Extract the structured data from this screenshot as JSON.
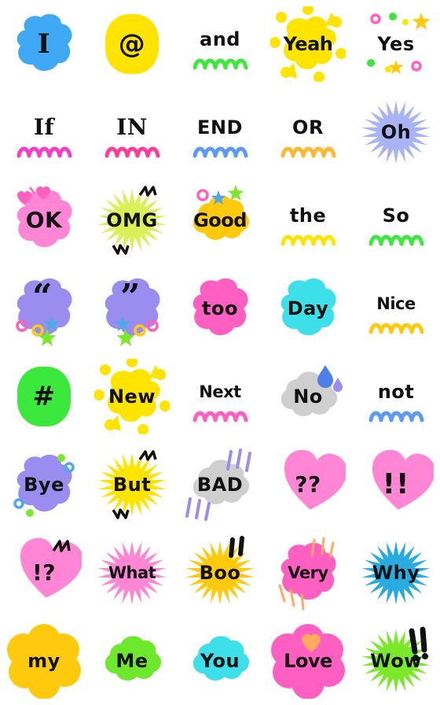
{
  "page": {
    "title": "Emoji sticker sheet",
    "background_color": "#ffffff",
    "grid": {
      "columns": 5,
      "rows": 8,
      "cell_size_px": 112
    },
    "text_color": "#111111"
  },
  "palette": {
    "blue": "#3FA9F5",
    "yellow": "#FFE400",
    "gold": "#FFC90E",
    "green": "#3DE83D",
    "lime": "#7BE82C",
    "yellow_green": "#D9F05A",
    "pink": "#FF85D5",
    "hot_pink": "#FF5FC0",
    "magenta": "#F53DC8",
    "purple": "#9B8CF0",
    "periwinkle": "#A8B4F5",
    "cyan": "#3DE0E8",
    "sky": "#29ABE2",
    "gray": "#CFCFCF",
    "orange": "#FFAA5C"
  },
  "stickers": [
    {
      "id": "i",
      "label": "I",
      "bg": "blob",
      "bg_color": "#3FA9F5",
      "deco": "none",
      "size": "s-xl",
      "font": "serif"
    },
    {
      "id": "at",
      "label": "@",
      "bg": "round",
      "bg_color": "#FFE400",
      "deco": "none",
      "size": "s-xl",
      "font": ""
    },
    {
      "id": "and",
      "label": "and",
      "bg": "none",
      "bg_color": "",
      "deco": "squiggle",
      "deco_color": "#3DE83D",
      "size": "s-md",
      "font": ""
    },
    {
      "id": "yeah",
      "label": "Yeah",
      "bg": "splat",
      "bg_color": "#FFE400",
      "deco": "none",
      "size": "s-md",
      "font": ""
    },
    {
      "id": "yes",
      "label": "Yes",
      "bg": "none",
      "bg_color": "",
      "deco": "confetti",
      "size": "s-md",
      "font": ""
    },
    {
      "id": "if",
      "label": "If",
      "bg": "none",
      "bg_color": "",
      "deco": "squiggle",
      "deco_color": "#F53DC8",
      "size": "s-lg",
      "font": "serif"
    },
    {
      "id": "in",
      "label": "IN",
      "bg": "none",
      "bg_color": "",
      "deco": "squiggle",
      "deco_color": "#FF3D98",
      "size": "s-lg",
      "font": "serif"
    },
    {
      "id": "end",
      "label": "END",
      "bg": "none",
      "bg_color": "",
      "deco": "squiggle",
      "deco_color": "#5B9BF5",
      "size": "s-md",
      "font": ""
    },
    {
      "id": "or",
      "label": "OR",
      "bg": "none",
      "bg_color": "",
      "deco": "squiggle",
      "deco_color": "#FFB830",
      "size": "s-md",
      "font": ""
    },
    {
      "id": "oh",
      "label": "Oh",
      "bg": "burst",
      "bg_color": "#A8B4F5",
      "deco": "none",
      "size": "s-md",
      "font": ""
    },
    {
      "id": "ok",
      "label": "OK",
      "bg": "blob",
      "bg_color": "#FF85D5",
      "deco": "hearts-small",
      "size": "s-lg",
      "font": ""
    },
    {
      "id": "omg",
      "label": "OMG",
      "bg": "burst",
      "bg_color": "#D9F05A",
      "deco": "zigzag",
      "size": "s-md",
      "font": ""
    },
    {
      "id": "good",
      "label": "Good",
      "bg": "cloud",
      "bg_color": "#FFC90E",
      "deco": "stars-top",
      "size": "s-md",
      "font": ""
    },
    {
      "id": "the",
      "label": "the",
      "bg": "none",
      "bg_color": "",
      "deco": "squiggle",
      "deco_color": "#FFE400",
      "size": "s-md",
      "font": ""
    },
    {
      "id": "so",
      "label": "So",
      "bg": "none",
      "bg_color": "",
      "deco": "squiggle",
      "deco_color": "#3DE83D",
      "size": "s-md",
      "font": ""
    },
    {
      "id": "quote-open",
      "label": "“",
      "bg": "blob",
      "bg_color": "#9B8CF0",
      "deco": "charms-left",
      "size": "s-xl",
      "font": "quote"
    },
    {
      "id": "quote-close",
      "label": "”",
      "bg": "blob",
      "bg_color": "#9B8CF0",
      "deco": "charms-right",
      "size": "s-xl",
      "font": "quote"
    },
    {
      "id": "too",
      "label": "too",
      "bg": "blob",
      "bg_color": "#FF5FC0",
      "deco": "none",
      "size": "s-md",
      "font": ""
    },
    {
      "id": "day",
      "label": "Day",
      "bg": "blob",
      "bg_color": "#3DE0E8",
      "deco": "none",
      "size": "s-md",
      "font": ""
    },
    {
      "id": "nice",
      "label": "Nice",
      "bg": "none",
      "bg_color": "",
      "deco": "squiggle",
      "deco_color": "#FFC90E",
      "size": "s-sm",
      "font": ""
    },
    {
      "id": "hash",
      "label": "#",
      "bg": "round",
      "bg_color": "#3DE83D",
      "deco": "none",
      "size": "s-xl",
      "font": ""
    },
    {
      "id": "new",
      "label": "New",
      "bg": "splat",
      "bg_color": "#FFE400",
      "deco": "none",
      "size": "s-md",
      "font": ""
    },
    {
      "id": "next",
      "label": "Next",
      "bg": "none",
      "bg_color": "",
      "deco": "squiggle",
      "deco_color": "#FF5FC0",
      "size": "s-sm",
      "font": ""
    },
    {
      "id": "no",
      "label": "No",
      "bg": "cloud",
      "bg_color": "#CFCFCF",
      "deco": "sweat-drops",
      "size": "s-md",
      "font": ""
    },
    {
      "id": "not",
      "label": "not",
      "bg": "none",
      "bg_color": "",
      "deco": "squiggle",
      "deco_color": "#5B9BF5",
      "size": "s-md",
      "font": ""
    },
    {
      "id": "bye",
      "label": "Bye",
      "bg": "blob",
      "bg_color": "#9B8CF0",
      "deco": "bubbles-green",
      "size": "s-md",
      "font": ""
    },
    {
      "id": "but",
      "label": "But",
      "bg": "burst",
      "bg_color": "#FFE400",
      "deco": "zigzag",
      "size": "s-md",
      "font": ""
    },
    {
      "id": "bad",
      "label": "BAD",
      "bg": "cloud",
      "bg_color": "#CFCFCF",
      "deco": "speed-lines",
      "size": "s-md",
      "font": ""
    },
    {
      "id": "question-marks",
      "label": "??",
      "bg": "heart",
      "bg_color": "#FF85D5",
      "deco": "none",
      "size": "s-lg",
      "font": ""
    },
    {
      "id": "exclamations",
      "label": "!!",
      "bg": "heart",
      "bg_color": "#FF85D5",
      "deco": "none",
      "size": "bang",
      "font": ""
    },
    {
      "id": "surprise",
      "label": "!?",
      "bg": "heart",
      "bg_color": "#FF85D5",
      "deco": "zigzag-small",
      "size": "s-lg",
      "font": ""
    },
    {
      "id": "what",
      "label": "What",
      "bg": "burst",
      "bg_color": "#FF85D5",
      "deco": "none",
      "size": "s-sm",
      "font": ""
    },
    {
      "id": "boo",
      "label": "Boo",
      "bg": "burst",
      "bg_color": "#FFC90E",
      "deco": "quote-ticks",
      "size": "s-md",
      "font": ""
    },
    {
      "id": "very",
      "label": "Very",
      "bg": "blob",
      "bg_color": "#FF5FC0",
      "deco": "orange-rays",
      "size": "s-sm",
      "font": ""
    },
    {
      "id": "why",
      "label": "Why",
      "bg": "burst",
      "bg_color": "#29ABE2",
      "deco": "none",
      "size": "s-md",
      "font": ""
    },
    {
      "id": "my",
      "label": "my",
      "bg": "flower",
      "bg_color": "#FFC90E",
      "deco": "none",
      "size": "s-md",
      "font": ""
    },
    {
      "id": "me",
      "label": "Me",
      "bg": "cloud",
      "bg_color": "#6EE82C",
      "deco": "none",
      "size": "s-md",
      "font": ""
    },
    {
      "id": "you",
      "label": "You",
      "bg": "cloud",
      "bg_color": "#3DE0E8",
      "deco": "none",
      "size": "s-md",
      "font": ""
    },
    {
      "id": "love",
      "label": "Love",
      "bg": "flower",
      "bg_color": "#FF5FC0",
      "deco": "heart-orange",
      "size": "s-md",
      "font": ""
    },
    {
      "id": "wow",
      "label": "Wow",
      "bg": "burst",
      "bg_color": "#7BE82C",
      "deco": "bangs-black",
      "size": "s-md",
      "font": ""
    }
  ]
}
